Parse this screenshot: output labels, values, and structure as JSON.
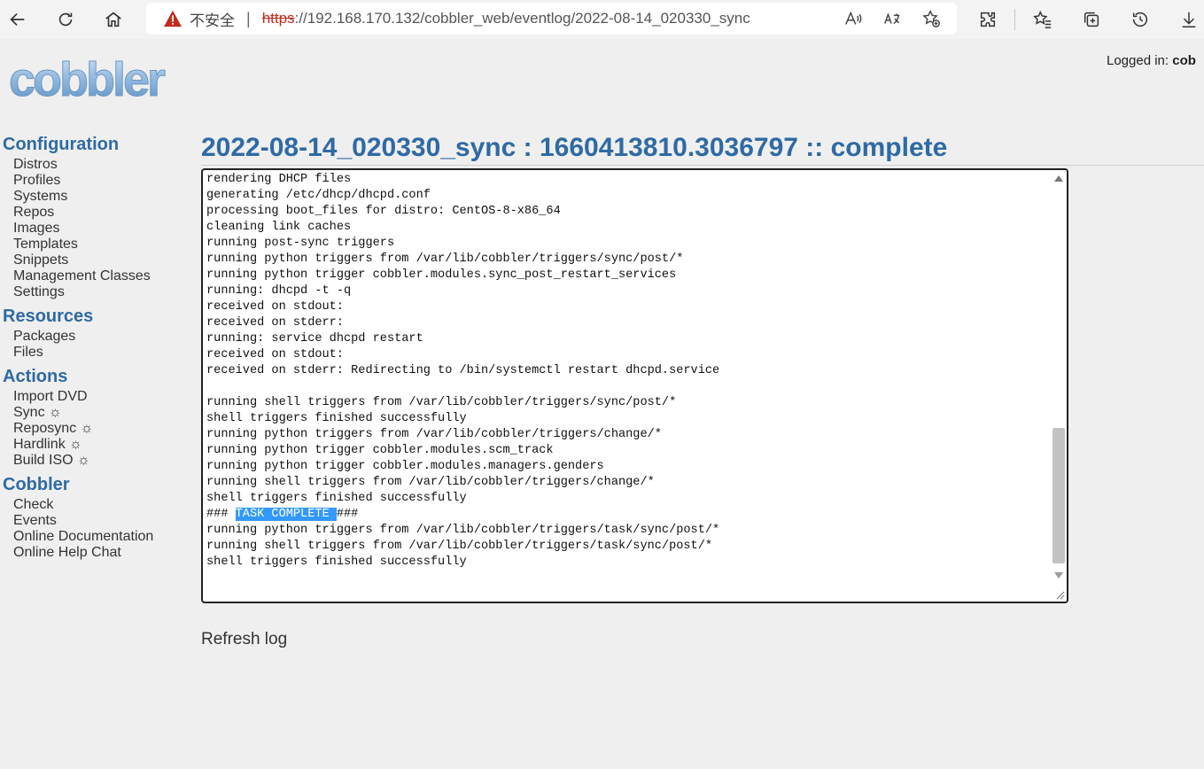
{
  "browser": {
    "security_label": "不安全",
    "url_protocol": "https",
    "url_rest": "://192.168.170.132/cobbler_web/eventlog/2022-08-14_020330_sync"
  },
  "header": {
    "logged_in_label": "Logged in:",
    "logged_in_user": "cob",
    "logo_text": "cobbler"
  },
  "sidebar": {
    "sections": [
      {
        "title": "Configuration",
        "items": [
          "Distros",
          "Profiles",
          "Systems",
          "Repos",
          "Images",
          "Templates",
          "Snippets",
          "Management Classes",
          "Settings"
        ]
      },
      {
        "title": "Resources",
        "items": [
          "Packages",
          "Files"
        ]
      },
      {
        "title": "Actions",
        "items": [
          "Import DVD",
          "Sync ☼",
          "Reposync ☼",
          "Hardlink ☼",
          "Build ISO ☼"
        ]
      },
      {
        "title": "Cobbler",
        "items": [
          "Check",
          "Events",
          "Online Documentation",
          "Online Help Chat"
        ]
      }
    ]
  },
  "main": {
    "title": "2022-08-14_020330_sync : 1660413810.3036797 :: complete",
    "log_lines": [
      "rendering DHCP files",
      "generating /etc/dhcp/dhcpd.conf",
      "processing boot_files for distro: CentOS-8-x86_64",
      "cleaning link caches",
      "running post-sync triggers",
      "running python triggers from /var/lib/cobbler/triggers/sync/post/*",
      "running python trigger cobbler.modules.sync_post_restart_services",
      "running: dhcpd -t -q",
      "received on stdout:",
      "received on stderr:",
      "running: service dhcpd restart",
      "received on stdout:",
      "received on stderr: Redirecting to /bin/systemctl restart dhcpd.service",
      "",
      "running shell triggers from /var/lib/cobbler/triggers/sync/post/*",
      "shell triggers finished successfully",
      "running python triggers from /var/lib/cobbler/triggers/change/*",
      "running python trigger cobbler.modules.scm_track",
      "running python trigger cobbler.modules.managers.genders",
      "running shell triggers from /var/lib/cobbler/triggers/change/*",
      "shell triggers finished successfully",
      "### TASK COMPLETE ###",
      "running python triggers from /var/lib/cobbler/triggers/task/sync/post/*",
      "running shell triggers from /var/lib/cobbler/triggers/task/sync/post/*",
      "shell triggers finished successfully"
    ],
    "highlighted_text": "TASK COMPLETE",
    "refresh_label": "Refresh log"
  },
  "colors": {
    "accent": "#2e6aa6",
    "selection": "#3399ff",
    "warning": "#c42b1c"
  }
}
